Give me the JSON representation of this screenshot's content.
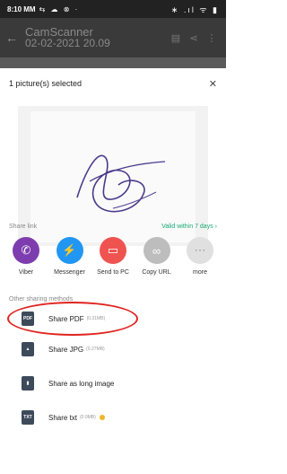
{
  "status": {
    "time": "8:10 MM",
    "left_icons": "⇆ ☁ ⊗ ·",
    "right_icons": "∗ .ıl ᯤ ▮"
  },
  "app_bar": {
    "title": "CamScanner",
    "subtitle": "02-02-2021 20.09"
  },
  "sheet": {
    "header": "1 picture(s) selected",
    "share_link_label": "Share link",
    "valid_text": "Valid within 7 days",
    "other_label": "Other sharing methods"
  },
  "apps": [
    {
      "name": "Viber",
      "color": "#7d3daf",
      "icon": "viber-icon"
    },
    {
      "name": "Messenger",
      "color": "#2196f3",
      "icon": "messenger-icon"
    },
    {
      "name": "Send to PC",
      "color": "#ef5350",
      "icon": "send-to-pc-icon"
    },
    {
      "name": "Copy URL",
      "color": "#bdbdbd",
      "icon": "link-icon"
    },
    {
      "name": "more",
      "color": "#e0e0e0",
      "icon": "more-icon"
    }
  ],
  "options": [
    {
      "label": "Share PDF",
      "size": "(0.31MB)",
      "icon_text": "PDF"
    },
    {
      "label": "Share JPG",
      "size": "(0.27MB)",
      "icon_text": ""
    },
    {
      "label": "Share as long image",
      "size": "",
      "icon_text": ""
    },
    {
      "label": "Share txt",
      "size": "(0.0MB)",
      "icon_text": "TXT"
    }
  ],
  "colors": {
    "accent": "#19a974",
    "highlight": "#e0241f"
  }
}
